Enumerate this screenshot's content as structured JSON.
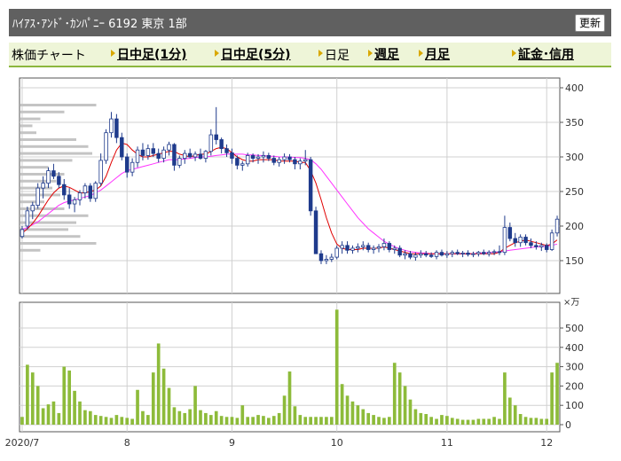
{
  "header": {
    "title": "ﾊｲｱｽ･ｱﾝﾄﾞ･ｶﾝﾊﾟﾆｰ  6192  東京 1部",
    "update_label": "更新"
  },
  "nav": {
    "label": "株価チャート",
    "links": [
      "日中足(1分)",
      "日中足(5分)",
      "日足",
      "週足",
      "月足",
      "証金･信用"
    ]
  },
  "colors": {
    "up": "#ffffff",
    "down": "#1f3b8c",
    "ma_short": "#e00000",
    "ma_long": "#ff33ff",
    "volume": "#8dbb3a",
    "grid": "#d0d0d0"
  },
  "chart_data": {
    "type": "candlestick",
    "price_axis": {
      "ticks": [
        "150",
        "200",
        "250",
        "300",
        "350",
        "400"
      ],
      "ylim": [
        150,
        400
      ]
    },
    "volume_axis": {
      "unit": "×万",
      "ticks": [
        "0",
        "100",
        "200",
        "300",
        "400",
        "500"
      ],
      "ylim": [
        0,
        500
      ]
    },
    "x_labels": [
      {
        "label": "2020/7",
        "idx": 0
      },
      {
        "label": "8",
        "idx": 20
      },
      {
        "label": "9",
        "idx": 40
      },
      {
        "label": "10",
        "idx": 60
      },
      {
        "label": "11",
        "idx": 81
      },
      {
        "label": "12",
        "idx": 100
      }
    ],
    "ohlc": [
      [
        185,
        200,
        182,
        195
      ],
      [
        200,
        228,
        195,
        222
      ],
      [
        222,
        235,
        210,
        230
      ],
      [
        230,
        262,
        225,
        255
      ],
      [
        255,
        272,
        240,
        262
      ],
      [
        262,
        285,
        255,
        280
      ],
      [
        280,
        290,
        268,
        272
      ],
      [
        272,
        278,
        255,
        260
      ],
      [
        260,
        268,
        238,
        245
      ],
      [
        245,
        255,
        225,
        232
      ],
      [
        232,
        242,
        220,
        238
      ],
      [
        238,
        252,
        230,
        248
      ],
      [
        248,
        262,
        240,
        258
      ],
      [
        258,
        262,
        235,
        240
      ],
      [
        240,
        265,
        235,
        262
      ],
      [
        262,
        305,
        258,
        295
      ],
      [
        295,
        340,
        290,
        335
      ],
      [
        335,
        365,
        328,
        355
      ],
      [
        355,
        362,
        320,
        328
      ],
      [
        328,
        335,
        295,
        300
      ],
      [
        300,
        305,
        270,
        278
      ],
      [
        278,
        298,
        272,
        292
      ],
      [
        292,
        315,
        285,
        310
      ],
      [
        310,
        320,
        295,
        302
      ],
      [
        302,
        318,
        296,
        312
      ],
      [
        312,
        320,
        300,
        305
      ],
      [
        305,
        312,
        292,
        298
      ],
      [
        298,
        315,
        292,
        310
      ],
      [
        310,
        322,
        302,
        318
      ],
      [
        318,
        320,
        280,
        288
      ],
      [
        288,
        302,
        284,
        298
      ],
      [
        298,
        310,
        290,
        305
      ],
      [
        305,
        312,
        298,
        300
      ],
      [
        300,
        308,
        294,
        304
      ],
      [
        304,
        312,
        296,
        298
      ],
      [
        298,
        310,
        292,
        308
      ],
      [
        308,
        340,
        302,
        332
      ],
      [
        332,
        372,
        318,
        325
      ],
      [
        325,
        328,
        305,
        312
      ],
      [
        312,
        318,
        300,
        306
      ],
      [
        306,
        312,
        290,
        298
      ],
      [
        298,
        302,
        282,
        288
      ],
      [
        288,
        294,
        280,
        290
      ],
      [
        290,
        306,
        286,
        302
      ],
      [
        302,
        305,
        292,
        298
      ],
      [
        298,
        304,
        290,
        300
      ],
      [
        300,
        308,
        292,
        302
      ],
      [
        302,
        306,
        294,
        298
      ],
      [
        298,
        302,
        288,
        292
      ],
      [
        292,
        300,
        286,
        296
      ],
      [
        296,
        305,
        290,
        300
      ],
      [
        300,
        304,
        292,
        296
      ],
      [
        296,
        300,
        282,
        290
      ],
      [
        290,
        298,
        282,
        294
      ],
      [
        294,
        310,
        288,
        296
      ],
      [
        296,
        300,
        215,
        222
      ],
      [
        222,
        228,
        165,
        160
      ],
      [
        160,
        165,
        145,
        150
      ],
      [
        150,
        158,
        145,
        152
      ],
      [
        152,
        160,
        148,
        155
      ],
      [
        155,
        172,
        152,
        168
      ],
      [
        168,
        178,
        160,
        172
      ],
      [
        172,
        178,
        160,
        165
      ],
      [
        165,
        172,
        160,
        168
      ],
      [
        168,
        175,
        162,
        170
      ],
      [
        170,
        178,
        165,
        172
      ],
      [
        172,
        176,
        162,
        166
      ],
      [
        166,
        172,
        160,
        168
      ],
      [
        168,
        174,
        162,
        170
      ],
      [
        170,
        182,
        165,
        175
      ],
      [
        175,
        178,
        162,
        166
      ],
      [
        166,
        172,
        160,
        168
      ],
      [
        168,
        172,
        155,
        158
      ],
      [
        158,
        165,
        152,
        160
      ],
      [
        160,
        164,
        152,
        155
      ],
      [
        155,
        162,
        150,
        158
      ],
      [
        158,
        165,
        154,
        160
      ],
      [
        160,
        164,
        155,
        158
      ],
      [
        158,
        162,
        154,
        156
      ],
      [
        156,
        165,
        152,
        162
      ],
      [
        162,
        166,
        156,
        158
      ],
      [
        158,
        164,
        154,
        160
      ],
      [
        160,
        165,
        155,
        162
      ],
      [
        162,
        166,
        158,
        160
      ],
      [
        160,
        164,
        155,
        161
      ],
      [
        161,
        165,
        156,
        159
      ],
      [
        159,
        163,
        155,
        160
      ],
      [
        160,
        164,
        156,
        162
      ],
      [
        162,
        166,
        158,
        160
      ],
      [
        160,
        165,
        156,
        162
      ],
      [
        162,
        166,
        158,
        163
      ],
      [
        163,
        172,
        158,
        162
      ],
      [
        162,
        215,
        158,
        198
      ],
      [
        198,
        205,
        178,
        182
      ],
      [
        182,
        190,
        170,
        176
      ],
      [
        176,
        188,
        170,
        184
      ],
      [
        184,
        188,
        172,
        176
      ],
      [
        176,
        182,
        168,
        172
      ],
      [
        172,
        178,
        166,
        170
      ],
      [
        170,
        176,
        164,
        172
      ],
      [
        172,
        175,
        162,
        166
      ],
      [
        166,
        195,
        164,
        190
      ],
      [
        190,
        215,
        185,
        210
      ]
    ],
    "ma_short": [
      190,
      196,
      204,
      214,
      226,
      238,
      248,
      255,
      258,
      256,
      252,
      248,
      248,
      250,
      252,
      258,
      272,
      292,
      310,
      320,
      318,
      310,
      304,
      300,
      300,
      302,
      304,
      306,
      308,
      308,
      304,
      302,
      300,
      302,
      304,
      304,
      308,
      312,
      314,
      312,
      306,
      300,
      296,
      294,
      294,
      296,
      296,
      296,
      296,
      294,
      294,
      294,
      294,
      292,
      292,
      280,
      262,
      238,
      212,
      190,
      174,
      168,
      166,
      166,
      166,
      168,
      168,
      168,
      168,
      170,
      168,
      166,
      164,
      162,
      160,
      160,
      160,
      160,
      160,
      160,
      160,
      160,
      160,
      160,
      160,
      160,
      160,
      160,
      160,
      160,
      160,
      162,
      168,
      172,
      176,
      178,
      180,
      178,
      176,
      174,
      172,
      174,
      180
    ],
    "ma_long": [
      195,
      198,
      202,
      206,
      212,
      218,
      224,
      230,
      234,
      236,
      238,
      240,
      242,
      244,
      248,
      252,
      258,
      264,
      270,
      276,
      280,
      282,
      284,
      286,
      288,
      290,
      292,
      294,
      296,
      296,
      296,
      297,
      298,
      299,
      300,
      300,
      301,
      302,
      303,
      304,
      304,
      304,
      304,
      303,
      303,
      302,
      302,
      301,
      301,
      300,
      300,
      300,
      299,
      299,
      298,
      296,
      290,
      282,
      272,
      262,
      252,
      242,
      232,
      222,
      212,
      204,
      196,
      190,
      184,
      178,
      174,
      170,
      167,
      165,
      163,
      162,
      161,
      161,
      160,
      160,
      160,
      160,
      160,
      160,
      160,
      160,
      160,
      161,
      161,
      162,
      162,
      163,
      164,
      165,
      166,
      167,
      168,
      169,
      170,
      170,
      171,
      172,
      174
    ],
    "volume": [
      40,
      310,
      270,
      200,
      85,
      105,
      120,
      60,
      300,
      280,
      175,
      120,
      75,
      70,
      50,
      45,
      40,
      35,
      50,
      40,
      35,
      30,
      180,
      70,
      50,
      270,
      420,
      290,
      190,
      90,
      70,
      60,
      80,
      200,
      75,
      60,
      50,
      70,
      45,
      40,
      40,
      35,
      100,
      40,
      40,
      50,
      45,
      35,
      45,
      60,
      150,
      275,
      95,
      50,
      40,
      40,
      40,
      40,
      40,
      40,
      595,
      210,
      150,
      120,
      100,
      80,
      60,
      50,
      40,
      35,
      40,
      320,
      270,
      200,
      130,
      80,
      60,
      55,
      40,
      30,
      50,
      45,
      35,
      30,
      25,
      25,
      25,
      30,
      30,
      30,
      40,
      30,
      270,
      140,
      100,
      55,
      40,
      35,
      35,
      30,
      30,
      270,
      320
    ],
    "volume_profile": [
      {
        "price": 375,
        "length": 0.95
      },
      {
        "price": 365,
        "length": 0.55
      },
      {
        "price": 355,
        "length": 0.25
      },
      {
        "price": 345,
        "length": 0.15
      },
      {
        "price": 335,
        "length": 0.2
      },
      {
        "price": 325,
        "length": 0.7
      },
      {
        "price": 315,
        "length": 0.85
      },
      {
        "price": 305,
        "length": 0.9
      },
      {
        "price": 295,
        "length": 0.65
      },
      {
        "price": 285,
        "length": 0.35
      },
      {
        "price": 275,
        "length": 0.55
      },
      {
        "price": 265,
        "length": 0.45
      },
      {
        "price": 255,
        "length": 0.4
      },
      {
        "price": 245,
        "length": 0.5
      },
      {
        "price": 235,
        "length": 0.3
      },
      {
        "price": 225,
        "length": 0.55
      },
      {
        "price": 215,
        "length": 0.85
      },
      {
        "price": 205,
        "length": 0.7
      },
      {
        "price": 195,
        "length": 0.6
      },
      {
        "price": 185,
        "length": 0.75
      },
      {
        "price": 175,
        "length": 0.95
      },
      {
        "price": 165,
        "length": 0.25
      }
    ]
  }
}
